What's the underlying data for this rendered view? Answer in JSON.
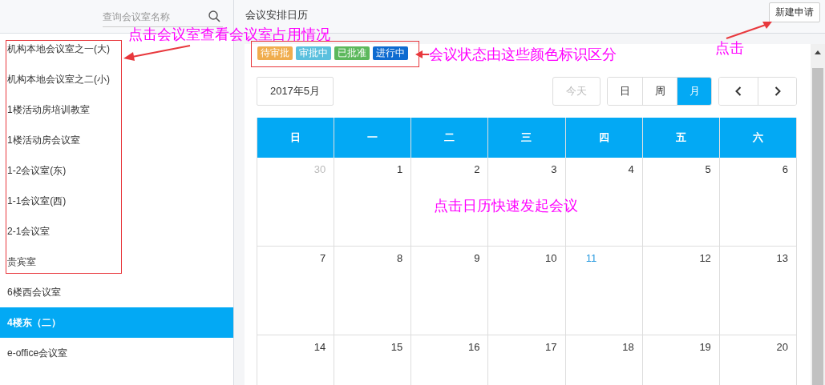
{
  "sidebar": {
    "search": {
      "placeholder": "查询会议室名称"
    },
    "items": [
      {
        "label": "机构本地会议室之一(大)",
        "selected": false
      },
      {
        "label": "机构本地会议室之二(小)",
        "selected": false
      },
      {
        "label": "1楼活动房培训教室",
        "selected": false
      },
      {
        "label": "1楼活动房会议室",
        "selected": false
      },
      {
        "label": "1-2会议室(东)",
        "selected": false
      },
      {
        "label": "1-1会议室(西)",
        "selected": false
      },
      {
        "label": "2-1会议室",
        "selected": false
      },
      {
        "label": "贵宾室",
        "selected": false
      },
      {
        "label": "6楼西会议室",
        "selected": false
      },
      {
        "label": "4楼东（二）",
        "selected": true
      },
      {
        "label": "e-office会议室",
        "selected": false
      }
    ]
  },
  "header": {
    "title": "会议安排日历",
    "new_button": "新建申请"
  },
  "legend": [
    {
      "label": "待审批",
      "color": "#f0ad4e"
    },
    {
      "label": "审批中",
      "color": "#5bc0de"
    },
    {
      "label": "已批准",
      "color": "#5cb85c"
    },
    {
      "label": "进行中",
      "color": "#0e6bd0"
    }
  ],
  "toolbar": {
    "month": "2017年5月",
    "today": {
      "label": "今天",
      "disabled": true
    },
    "views": [
      {
        "label": "日",
        "selected": false
      },
      {
        "label": "周",
        "selected": false
      },
      {
        "label": "月",
        "selected": true
      }
    ]
  },
  "calendar": {
    "weekdays": [
      "日",
      "一",
      "二",
      "三",
      "四",
      "五",
      "六"
    ],
    "weeks": [
      [
        {
          "day": "30",
          "kind": "other"
        },
        {
          "day": "1",
          "kind": "normal"
        },
        {
          "day": "2",
          "kind": "normal"
        },
        {
          "day": "3",
          "kind": "normal"
        },
        {
          "day": "4",
          "kind": "normal"
        },
        {
          "day": "5",
          "kind": "normal"
        },
        {
          "day": "6",
          "kind": "normal"
        }
      ],
      [
        {
          "day": "7",
          "kind": "normal"
        },
        {
          "day": "8",
          "kind": "normal"
        },
        {
          "day": "9",
          "kind": "normal"
        },
        {
          "day": "10",
          "kind": "normal"
        },
        {
          "day": "11",
          "kind": "today"
        },
        {
          "day": "12",
          "kind": "normal"
        },
        {
          "day": "13",
          "kind": "normal"
        }
      ],
      [
        {
          "day": "14",
          "kind": "normal"
        },
        {
          "day": "15",
          "kind": "normal"
        },
        {
          "day": "16",
          "kind": "normal"
        },
        {
          "day": "17",
          "kind": "normal"
        },
        {
          "day": "18",
          "kind": "normal"
        },
        {
          "day": "19",
          "kind": "normal"
        },
        {
          "day": "20",
          "kind": "normal"
        }
      ]
    ]
  },
  "annotations": [
    "点击会议室查看会议室占用情况",
    "会议状态由这些颜色标识区分",
    "点击",
    "点击日历快速发起会议"
  ]
}
